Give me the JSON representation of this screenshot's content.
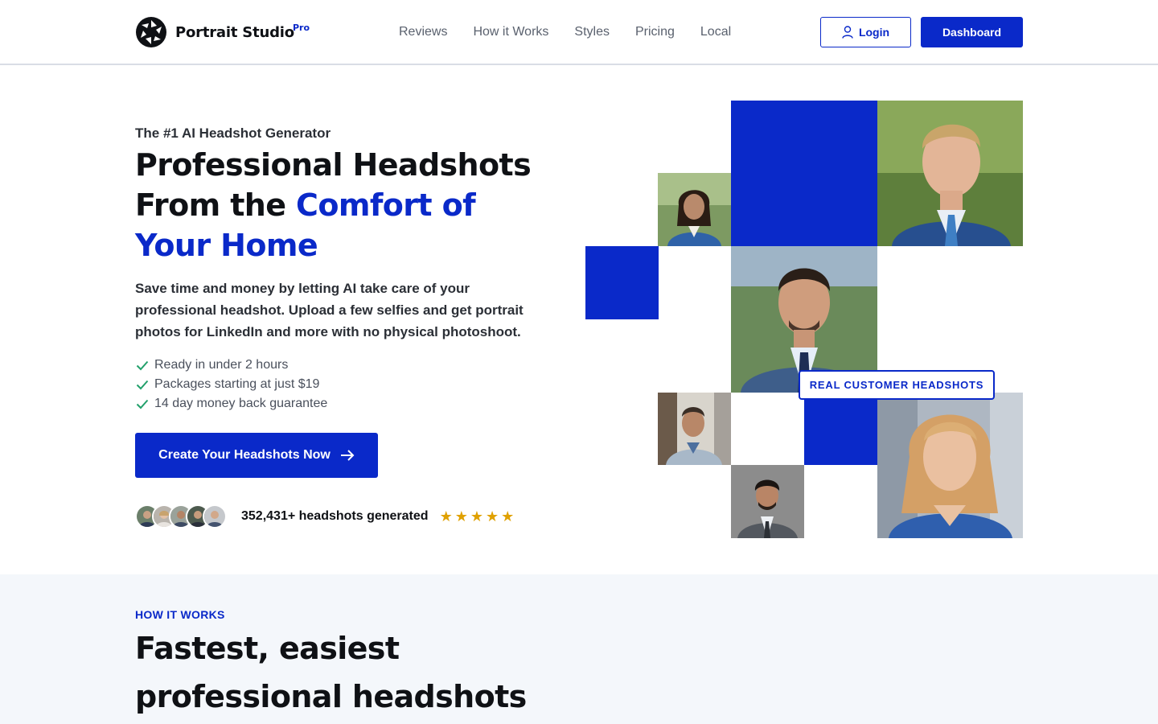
{
  "brand": {
    "name": "Portrait Studio",
    "tier": "Pro"
  },
  "nav": {
    "items": [
      "Reviews",
      "How it Works",
      "Styles",
      "Pricing",
      "Local"
    ]
  },
  "header": {
    "login_label": "Login",
    "dashboard_label": "Dashboard"
  },
  "hero": {
    "eyebrow": "The #1 AI Headshot Generator",
    "title_plain": "Professional Headshots From the ",
    "title_accent": "Comfort of Your Home",
    "description": "Save time and money by letting AI take care of your professional headshot. Upload a few selfies and get portrait photos for LinkedIn and more with no physical photoshoot.",
    "checks": [
      "Ready in under 2 hours",
      "Packages starting at just $19",
      "14 day money back guarantee"
    ],
    "cta_label": "Create Your Headshots Now",
    "proof_text": "352,431+ headshots generated",
    "stars": [
      "★",
      "★",
      "★",
      "★",
      "★"
    ],
    "rating": 5
  },
  "mosaic": {
    "badge": "REAL CUSTOMER HEADSHOTS"
  },
  "how": {
    "eyebrow": "HOW IT WORKS",
    "title": "Fastest, easiest professional headshots"
  },
  "colors": {
    "accent": "#0a29c9",
    "star": "#e0a100",
    "check": "#22a06b",
    "section_bg": "#f4f7fb"
  },
  "icons": [
    "aperture-logo-icon",
    "user-icon",
    "check-icon",
    "arrow-right-icon",
    "star-icon"
  ]
}
